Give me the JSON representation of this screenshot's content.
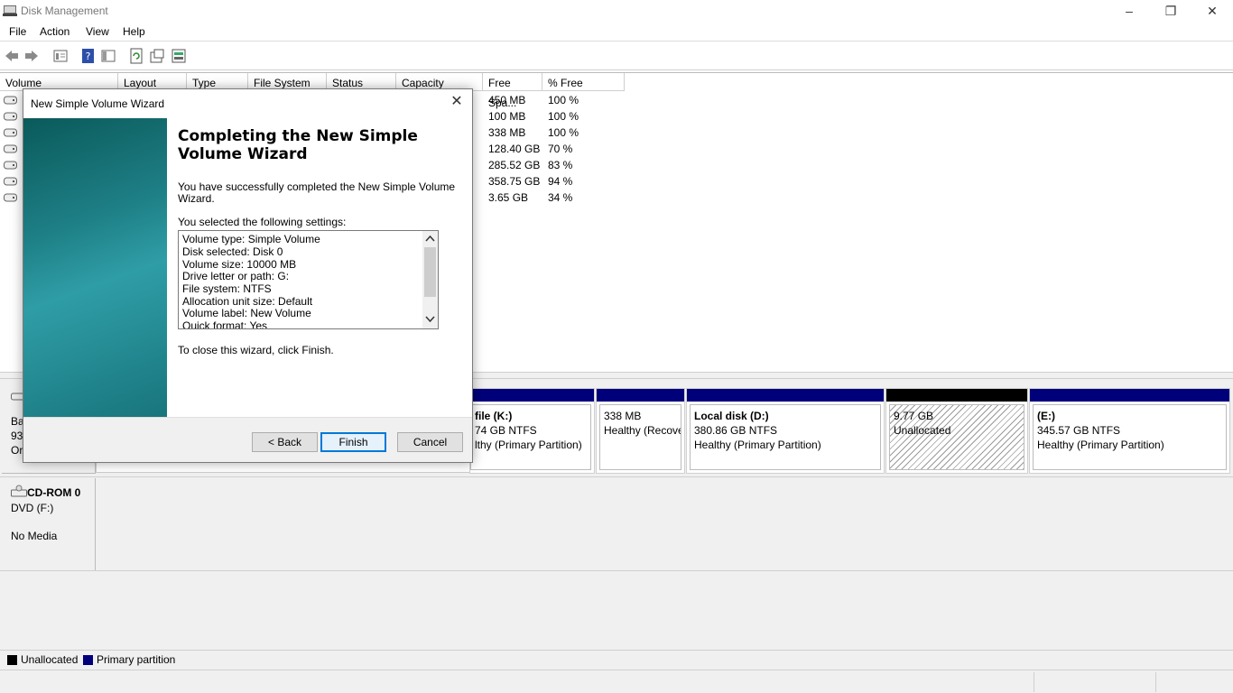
{
  "window": {
    "title": "Disk Management",
    "minimize": "–",
    "restore": "❐",
    "close": "✕"
  },
  "menu": [
    "File",
    "Action",
    "View",
    "Help"
  ],
  "columns": [
    "Volume",
    "Layout",
    "Type",
    "File System",
    "Status",
    "Capacity",
    "Free Spa...",
    "% Free"
  ],
  "volumes": [
    {
      "free": "450 MB",
      "pct": "100 %"
    },
    {
      "free": "100 MB",
      "pct": "100 %"
    },
    {
      "free": "338 MB",
      "pct": "100 %"
    },
    {
      "free": "128.40 GB",
      "pct": "70 %"
    },
    {
      "free": "285.52 GB",
      "pct": "83 %"
    },
    {
      "free": "358.75 GB",
      "pct": "94 %"
    },
    {
      "free": "3.65 GB",
      "pct": "34 %"
    }
  ],
  "disk0": {
    "label_partial": [
      "Ba",
      "93",
      "Or"
    ],
    "partitions": [
      {
        "name": "file  (K:)",
        "size": "74 GB NTFS",
        "status": "lthy (Primary Partition)"
      },
      {
        "name": "",
        "size": "338 MB",
        "status": "Healthy (Recove"
      },
      {
        "name": "Local disk  (D:)",
        "size": "380.86 GB NTFS",
        "status": "Healthy (Primary Partition)"
      },
      {
        "name": "",
        "size": "9.77 GB",
        "status": "Unallocated"
      },
      {
        "name": "(E:)",
        "size": "345.57 GB NTFS",
        "status": "Healthy (Primary Partition)"
      }
    ]
  },
  "cdrom": {
    "name": "CD-ROM 0",
    "type": "DVD (F:)",
    "media": "No Media"
  },
  "legend": {
    "unallocated": "Unallocated",
    "primary": "Primary partition"
  },
  "colors": {
    "primary": "#00007a",
    "unallocated": "#000000",
    "accent": "#0078d7"
  },
  "wizard": {
    "title": "New Simple Volume Wizard",
    "close": "✕",
    "heading_line1": "Completing the New Simple",
    "heading_line2": "Volume Wizard",
    "success_line1": "You have successfully completed the New Simple Volume",
    "success_line2": "Wizard.",
    "settings_label": "You selected the following settings:",
    "settings": [
      "Volume type: Simple Volume",
      "Disk selected: Disk 0",
      "Volume size: 10000 MB",
      "Drive letter or path: G:",
      "File system: NTFS",
      "Allocation unit size: Default",
      "Volume label: New Volume",
      "Quick format: Yes"
    ],
    "close_hint": "To close this wizard, click Finish.",
    "back": "< Back",
    "finish": "Finish",
    "cancel": "Cancel"
  }
}
